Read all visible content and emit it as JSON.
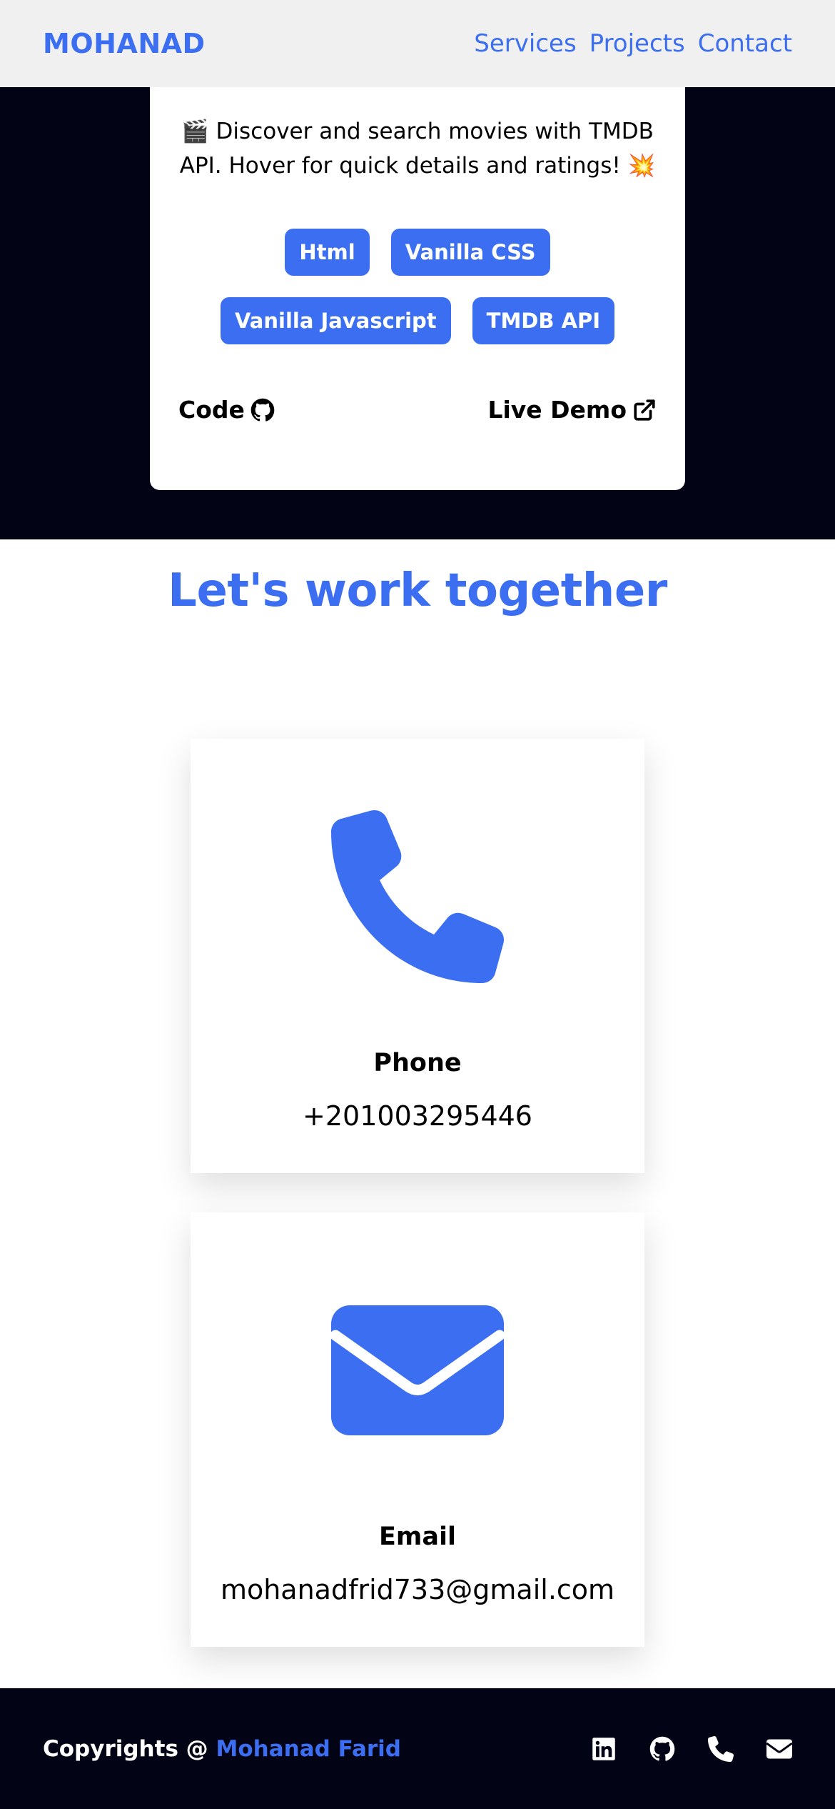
{
  "header": {
    "brand": "MOHANAD",
    "nav": [
      "Services",
      "Projects",
      "Contact"
    ]
  },
  "project": {
    "description": "🎬 Discover and search movies with TMDB API. Hover for quick details and ratings! 💥",
    "tags": [
      "Html",
      "Vanilla CSS",
      "Vanilla Javascript",
      "TMDB API"
    ],
    "code_label": "Code",
    "live_demo_label": "Live Demo",
    "code_icon": "github-icon",
    "live_demo_icon": "external-link-icon"
  },
  "contact": {
    "title": "Let's work together",
    "phone": {
      "label": "Phone",
      "value": "+201003295446",
      "icon": "phone-icon"
    },
    "email": {
      "label": "Email",
      "value": "mohanadfrid733@gmail.com",
      "icon": "envelope-icon"
    }
  },
  "footer": {
    "copyright_prefix": "Copyrights @ ",
    "name": "Mohanad Farid",
    "socials": [
      "linkedin-icon",
      "github-icon",
      "phone-icon",
      "envelope-icon"
    ]
  },
  "colors": {
    "accent": "#3b6ef0",
    "dark": "#020314",
    "header_bg": "#f0f0f1"
  }
}
